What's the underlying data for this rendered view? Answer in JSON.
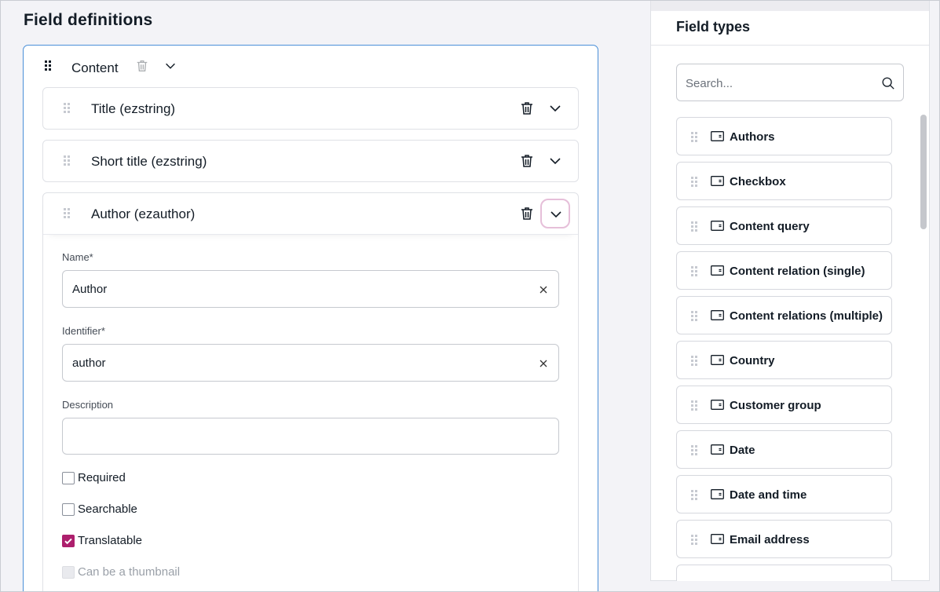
{
  "page_title": "Field definitions",
  "group": {
    "label": "Content"
  },
  "fields": [
    {
      "label": "Title (ezstring)"
    },
    {
      "label": "Short title (ezstring)"
    },
    {
      "label": "Author (ezauthor)"
    }
  ],
  "field_form": {
    "name_label": "Name*",
    "name_value": "Author",
    "identifier_label": "Identifier*",
    "identifier_value": "author",
    "description_label": "Description",
    "description_value": "",
    "checkboxes": [
      {
        "label": "Required",
        "checked": false,
        "disabled": false
      },
      {
        "label": "Searchable",
        "checked": false,
        "disabled": false
      },
      {
        "label": "Translatable",
        "checked": true,
        "disabled": false
      },
      {
        "label": "Can be a thumbnail",
        "checked": false,
        "disabled": true
      }
    ]
  },
  "field_types": {
    "title": "Field types",
    "search_placeholder": "Search...",
    "items": [
      {
        "label": "Authors"
      },
      {
        "label": "Checkbox"
      },
      {
        "label": "Content query"
      },
      {
        "label": "Content relation (single)"
      },
      {
        "label": "Content relations (multiple)"
      },
      {
        "label": "Country"
      },
      {
        "label": "Customer group"
      },
      {
        "label": "Date"
      },
      {
        "label": "Date and time"
      },
      {
        "label": "Email address"
      }
    ]
  },
  "colors": {
    "accent": "#ad1f6d",
    "focus_border": "#4a8fd8",
    "focus_ring": "#e6bfd9"
  },
  "icons": {
    "drag": "drag-handle-icon",
    "trash": "trash-icon",
    "chevron": "chevron-down-icon",
    "clear": "close-icon",
    "search": "search-icon",
    "field_type": "field-type-icon"
  }
}
